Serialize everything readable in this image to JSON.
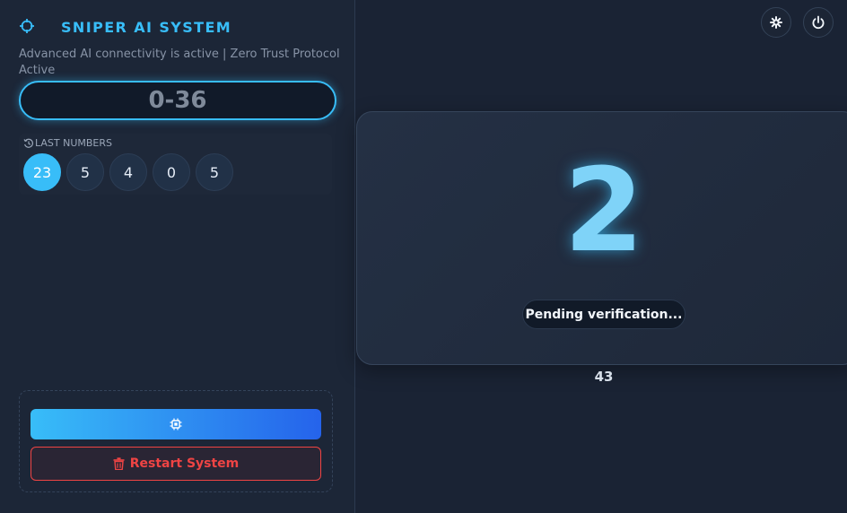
{
  "header": {
    "title": "SNIPER AI SYSTEM",
    "subtitle": "Advanced AI connectivity is active | Zero Trust Protocol Active",
    "brand_icon": "crosshair-icon"
  },
  "range": {
    "value": "0-36"
  },
  "last_numbers": {
    "label": "LAST NUMBERS",
    "icon": "history-icon",
    "values": [
      "23",
      "5",
      "4",
      "0",
      "5"
    ]
  },
  "actions": {
    "ai_button_icon": "chip-icon",
    "restart_label": "Restart System",
    "restart_icon": "trash-icon"
  },
  "toolbar": {
    "settings_icon": "gear-icon",
    "power_icon": "power-icon"
  },
  "result": {
    "number": "2",
    "status": "Pending verification...",
    "count": "43"
  },
  "colors": {
    "accent": "#38bdf8",
    "accent_dark": "#2563eb",
    "danger": "#ef4444",
    "background": "#1a2334"
  }
}
